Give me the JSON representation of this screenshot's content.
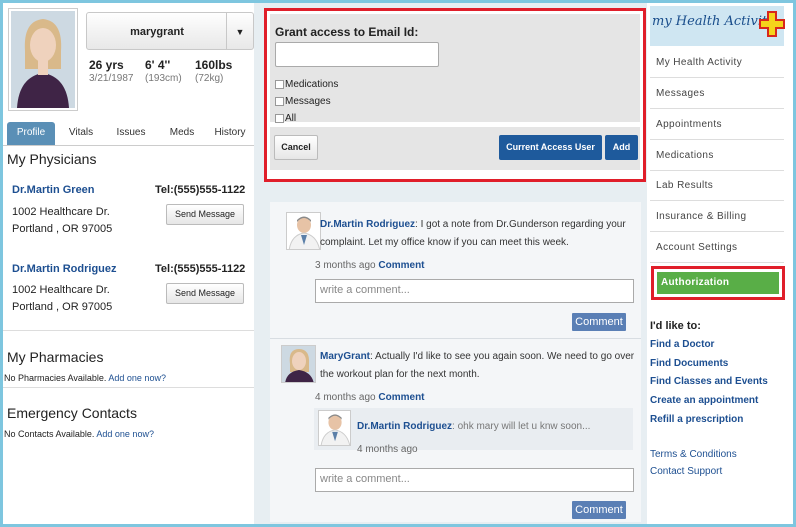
{
  "profile": {
    "username": "marygrant",
    "age": "26 yrs",
    "dob": "3/21/1987",
    "height": "6' 4''",
    "height_cm": "(193cm)",
    "weight": "160lbs",
    "weight_kg": "(72kg)"
  },
  "tabs": [
    "Profile",
    "Vitals",
    "Issues",
    "Meds",
    "History"
  ],
  "physicians": {
    "title": "My Physicians",
    "items": [
      {
        "name": "Dr.Martin Green",
        "tel": "Tel:(555)555-1122",
        "addr1": "1002 Healthcare Dr.",
        "addr2": "Portland , OR 97005",
        "button": "Send Message"
      },
      {
        "name": "Dr.Martin Rodriguez",
        "tel": "Tel:(555)555-1122",
        "addr1": "1002 Healthcare Dr.",
        "addr2": "Portland , OR 97005",
        "button": "Send Message"
      }
    ]
  },
  "pharmacies": {
    "title": "My Pharmacies",
    "note": "No Pharmacies Available.",
    "add": "Add one now?"
  },
  "contacts": {
    "title": "Emergency Contacts",
    "note": "No Contacts Available.",
    "add": "Add one now?"
  },
  "grant": {
    "label": "Grant access to Email Id:",
    "options": [
      "Medications",
      "Messages",
      "All"
    ],
    "cancel": "Cancel",
    "current": "Current Access User",
    "add": "Add"
  },
  "feed": {
    "posts": [
      {
        "author": "Dr.Martin Rodriguez",
        "text": ": I got a note from Dr.Gunderson regarding your complaint. Let my office know if you can meet this week.",
        "time": "3 months ago",
        "comment_link": "Comment",
        "placeholder": "write a comment...",
        "button": "Comment"
      },
      {
        "author": "MaryGrant",
        "text": ": Actually I'd like to see you again soon. We need to go over the workout plan for the next month.",
        "time": "4 months ago",
        "comment_link": "Comment",
        "placeholder": "write a comment...",
        "button": "Comment",
        "reply": {
          "author": "Dr.Martin Rodriguez",
          "text": ": ohk mary will let u knw soon...",
          "time": "4 months ago"
        }
      }
    ]
  },
  "brand": {
    "logo_text": "my Health Activity"
  },
  "nav": [
    "My Health Activity",
    "Messages",
    "Appointments",
    "Medications",
    "Lab Results",
    "Insurance & Billing",
    "Account Settings"
  ],
  "nav_active": "Authorization",
  "like": {
    "title": "I'd like to:",
    "links": [
      "Find a Doctor",
      "Find Documents",
      "Find Classes and Events",
      "Create an appointment",
      "Refill a prescription"
    ]
  },
  "footer": {
    "terms": "Terms & Conditions",
    "support": "Contact Support"
  }
}
